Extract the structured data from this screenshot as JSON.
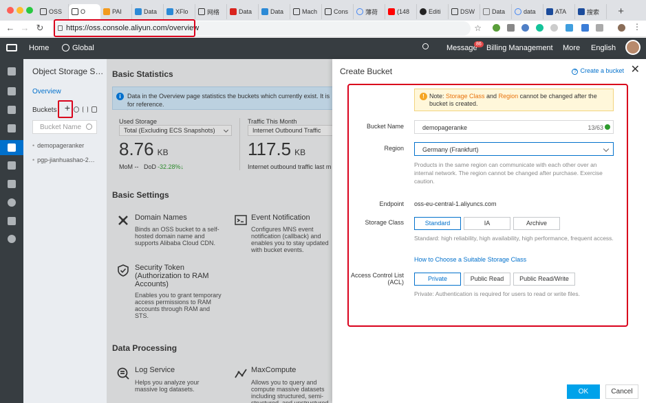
{
  "browser": {
    "tabs": [
      {
        "label": "OSS"
      },
      {
        "label": "O"
      },
      {
        "label": "PAI"
      },
      {
        "label": "Data"
      },
      {
        "label": "XFlo"
      },
      {
        "label": "网络"
      },
      {
        "label": "Data"
      },
      {
        "label": "Data"
      },
      {
        "label": "Mach"
      },
      {
        "label": "Cons"
      },
      {
        "label": "薄荷"
      },
      {
        "label": "(148"
      },
      {
        "label": "Editi"
      },
      {
        "label": "DSW"
      },
      {
        "label": "Data"
      },
      {
        "label": "data"
      },
      {
        "label": "ATA"
      },
      {
        "label": "搜索"
      }
    ],
    "url": "https://oss.console.aliyun.com/overview"
  },
  "topnav": {
    "home": "Home",
    "region": "Global",
    "message": "Message",
    "message_count": "86",
    "billing": "Billing Management",
    "more": "More",
    "language": "English"
  },
  "sidebar": {
    "title": "Object Storage S…",
    "overview": "Overview",
    "buckets_label": "Buckets",
    "add": "+",
    "search_placeholder": "Bucket Name",
    "buckets": [
      "demopageranker",
      "pgp-jianhuashao-2…"
    ]
  },
  "main": {
    "basic_statistics": "Basic Statistics",
    "notice": "Data in the Overview page statistics the buckets which currently exist. It is for reference.",
    "used_storage_label": "Used Storage",
    "used_storage_select": "Total (Excluding ECS Snapshots)",
    "used_storage_value": "8.76",
    "used_storage_unit": "KB",
    "mom": "MoM --",
    "dod_label": "DoD",
    "dod_value": "-32.28%↓",
    "traffic_label": "Traffic This Month",
    "traffic_select": "Internet Outbound Traffic",
    "traffic_value": "117.5",
    "traffic_unit": "KB",
    "traffic_desc": "Internet outbound traffic last m",
    "basic_settings": "Basic Settings",
    "domain_title": "Domain Names",
    "domain_desc": "Binds an OSS bucket to a self-hosted domain name and supports Alibaba Cloud CDN.",
    "event_title": "Event Notification",
    "event_desc": "Configures MNS event notification (callback) and enables you to stay updated with bucket events.",
    "sts_title": "Security Token (Authorization to RAM Accounts)",
    "sts_desc": "Enables you to grant temporary access permissions to RAM accounts through RAM and STS.",
    "data_processing": "Data Processing",
    "log_title": "Log Service",
    "log_desc": "Helps you analyze your massive log datasets.",
    "mc_title": "MaxCompute",
    "mc_desc": "Allows you to query and compute massive datasets including structured, semi-structured, and unstructured"
  },
  "drawer": {
    "title": "Create Bucket",
    "help_link": "Create a bucket",
    "note_prefix": "Note: ",
    "note_storage_class": "Storage Class",
    "note_and": " and ",
    "note_region": "Region",
    "note_suffix": " cannot be changed after the bucket is created.",
    "bucket_name_label": "Bucket Name",
    "bucket_name_value": "demopageranke",
    "bucket_name_count": "13/63",
    "region_label": "Region",
    "region_value": "Germany (Frankfurt)",
    "region_hint": "Products in the same region can communicate with each other over an internal network. The region cannot be changed after purchase. Exercise caution.",
    "endpoint_label": "Endpoint",
    "endpoint_value": "oss-eu-central-1.aliyuncs.com",
    "storage_class_label": "Storage Class",
    "storage_options": [
      "Standard",
      "IA",
      "Archive"
    ],
    "storage_hint": "Standard: high reliability, high availability, high performance, frequent access.",
    "storage_link": "How to Choose a Suitable Storage Class",
    "acl_label": "Access Control List (ACL)",
    "acl_options": [
      "Private",
      "Public Read",
      "Public Read/Write"
    ],
    "acl_hint": "Private: Authentication is required for users to read or write files.",
    "ok": "OK",
    "cancel": "Cancel"
  },
  "colors": {
    "accent": "#0070cc",
    "highlight": "#d9001b",
    "ok_button": "#00a2ea",
    "topnav": "#373d41"
  }
}
